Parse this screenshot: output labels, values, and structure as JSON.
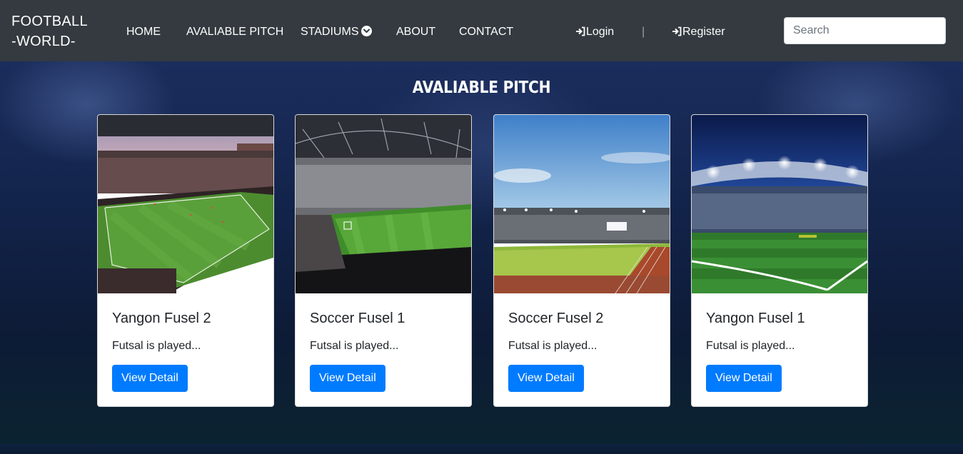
{
  "navbar": {
    "brand_line1": "FOOTBALL",
    "brand_line2": "-WORLD-",
    "links": [
      {
        "label": "HOME"
      },
      {
        "label": "AVALIABLE PITCH"
      },
      {
        "label": "STADIUMS"
      },
      {
        "label": "ABOUT"
      },
      {
        "label": "CONTACT"
      }
    ],
    "login_label": "Login",
    "divider": "|",
    "register_label": "Register",
    "search_placeholder": "Search",
    "icons": {
      "stadiums_dropdown": "chevron-circle-down-icon",
      "login": "sign-in-icon",
      "register": "sign-in-icon"
    }
  },
  "main": {
    "section_title": "AVALIABLE PITCH",
    "cards": [
      {
        "title": "Yangon Fusel 2",
        "text": "Futsal is played...",
        "button": "View Detail",
        "image": "stadium-photo-crowd"
      },
      {
        "title": "Soccer Fusel 1",
        "text": "Futsal is played...",
        "button": "View Detail",
        "image": "stadium-photo-night"
      },
      {
        "title": "Soccer Fusel 2",
        "text": "Futsal is played...",
        "button": "View Detail",
        "image": "stadium-photo-daylight"
      },
      {
        "title": "Yangon Fusel 1",
        "text": "Futsal is played...",
        "button": "View Detail",
        "image": "stadium-photo-floodlights"
      }
    ]
  },
  "colors": {
    "navbar_bg": "#343a40",
    "primary_button": "#007bff",
    "hero_bg": "#13244c"
  }
}
